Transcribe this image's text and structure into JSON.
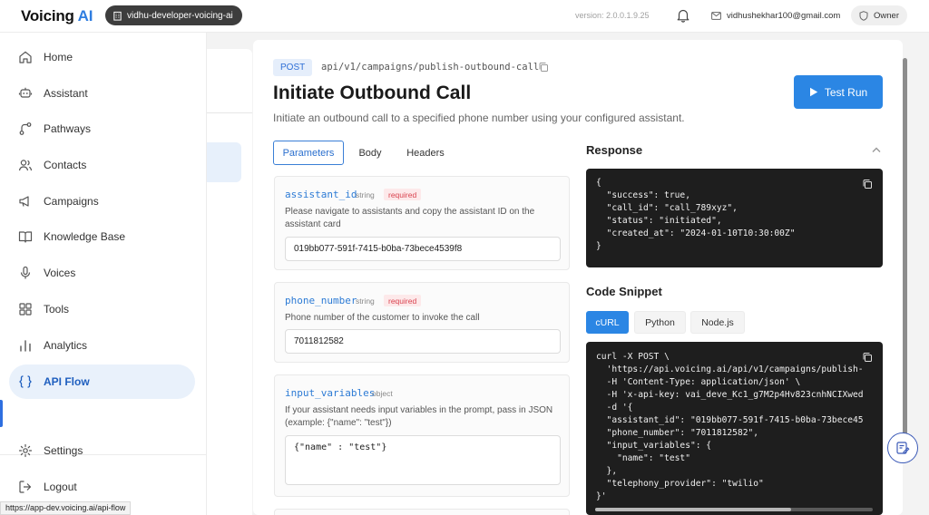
{
  "brand": {
    "name": "Voicing",
    "suffix": "AI"
  },
  "header": {
    "org": "vidhu-developer-voicing-ai",
    "version": "version: 2.0.0.1.9.25",
    "email": "vidhushekhar100@gmail.com",
    "role": "Owner"
  },
  "sidebar": {
    "items": [
      {
        "label": "Home",
        "icon": "home-icon"
      },
      {
        "label": "Assistant",
        "icon": "assistant-icon"
      },
      {
        "label": "Pathways",
        "icon": "pathways-icon"
      },
      {
        "label": "Contacts",
        "icon": "contacts-icon"
      },
      {
        "label": "Campaigns",
        "icon": "campaigns-icon"
      },
      {
        "label": "Knowledge Base",
        "icon": "book-icon"
      },
      {
        "label": "Voices",
        "icon": "mic-icon"
      },
      {
        "label": "Tools",
        "icon": "grid-icon"
      },
      {
        "label": "Analytics",
        "icon": "bar-chart-icon"
      },
      {
        "label": "API Flow",
        "icon": "braces-icon"
      }
    ],
    "active": "API Flow",
    "bottom": [
      {
        "label": "Settings",
        "icon": "gear-icon"
      },
      {
        "label": "Logout",
        "icon": "logout-icon"
      }
    ],
    "status_url": "https://app-dev.voicing.ai/api-flow"
  },
  "endpoint": {
    "method": "POST",
    "path": "api/v1/campaigns/publish-outbound-call",
    "title": "Initiate Outbound Call",
    "description": "Initiate an outbound call to a specified phone number using your configured assistant.",
    "test_run_label": "Test Run"
  },
  "tabs": [
    "Parameters",
    "Body",
    "Headers"
  ],
  "active_tab": "Parameters",
  "params": [
    {
      "name": "assistant_id",
      "type": "string",
      "required": "required",
      "description": "Please navigate to assistants and copy the assistant ID on the assistant card",
      "value": "019bb077-591f-7415-b0ba-73bece4539f8"
    },
    {
      "name": "phone_number",
      "type": "string",
      "required": "required",
      "description": "Phone number of the customer to invoke the call",
      "value": "7011812582"
    },
    {
      "name": "input_variables",
      "type": "object",
      "description": "If your assistant needs input variables in the prompt, pass in JSON (example: {\"name\": \"test\"})",
      "value": "{\"name\" : \"test\"}"
    }
  ],
  "response": {
    "title": "Response",
    "code": "{\n  \"success\": true,\n  \"call_id\": \"call_789xyz\",\n  \"status\": \"initiated\",\n  \"created_at\": \"2024-01-10T10:30:00Z\"\n}"
  },
  "snippet": {
    "title": "Code Snippet",
    "languages": [
      "cURL",
      "Python",
      "Node.js"
    ],
    "active_language": "cURL",
    "code": "curl -X POST \\\n  'https://api.voicing.ai/api/v1/campaigns/publish-\n  -H 'Content-Type: application/json' \\\n  -H 'x-api-key: vai_deve_Kc1_g7M2p4Hv823cnhNCIXwed\n  -d '{\n  \"assistant_id\": \"019bb077-591f-7415-b0ba-73bece45\n  \"phone_number\": \"7011812582\",\n  \"input_variables\": {\n    \"name\": \"test\"\n  },\n  \"telephony_provider\": \"twilio\"\n}'"
  },
  "colors": {
    "accent": "#2b86e4",
    "active_nav_bg": "#e9f1fb",
    "code_bg": "#1e1e1e",
    "required_text": "#d9434f"
  }
}
